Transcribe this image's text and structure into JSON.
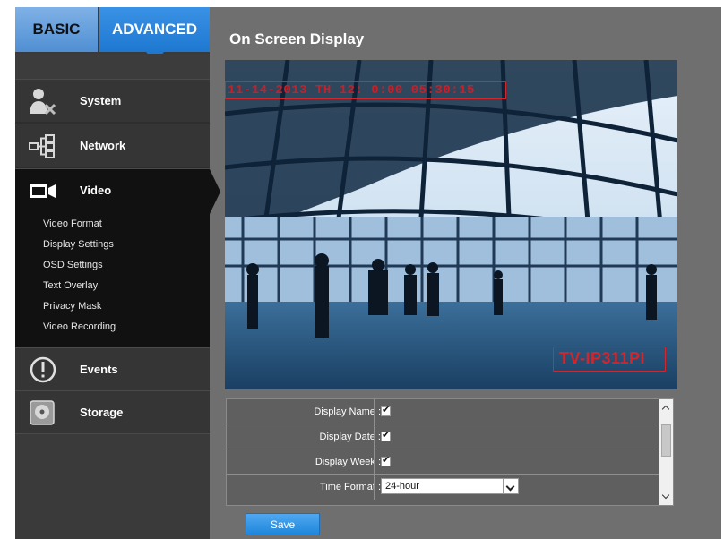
{
  "tabs": {
    "basic": "BASIC",
    "advanced": "ADVANCED"
  },
  "sidebar": {
    "items": [
      {
        "label": "System",
        "icon": "system-icon"
      },
      {
        "label": "Network",
        "icon": "network-icon"
      },
      {
        "label": "Video",
        "icon": "video-camera-icon"
      },
      {
        "label": "Events",
        "icon": "events-icon"
      },
      {
        "label": "Storage",
        "icon": "storage-icon"
      }
    ],
    "video_submenu": [
      "Video Format",
      "Display Settings",
      "OSD Settings",
      "Text Overlay",
      "Privacy Mask",
      "Video Recording"
    ]
  },
  "main": {
    "title": "On Screen Display",
    "preview": {
      "osd_text": "11-14-2013 TH 12: 0:00 05:30:15",
      "camera_name": "TV-IP311PI"
    },
    "settings": {
      "display_name_label": "Display Name :",
      "display_date_label": "Display Date :",
      "display_week_label": "Display Week :",
      "time_format_label": "Time Format :",
      "time_format_value": "24-hour",
      "display_name_checked": true,
      "display_date_checked": true,
      "display_week_checked": true
    },
    "save_label": "Save"
  },
  "colors": {
    "accent": "#1f78d0",
    "sidebar_bg": "#2e2e2e",
    "main_bg": "#6f6f6f",
    "osd_red": "#d0262c"
  }
}
